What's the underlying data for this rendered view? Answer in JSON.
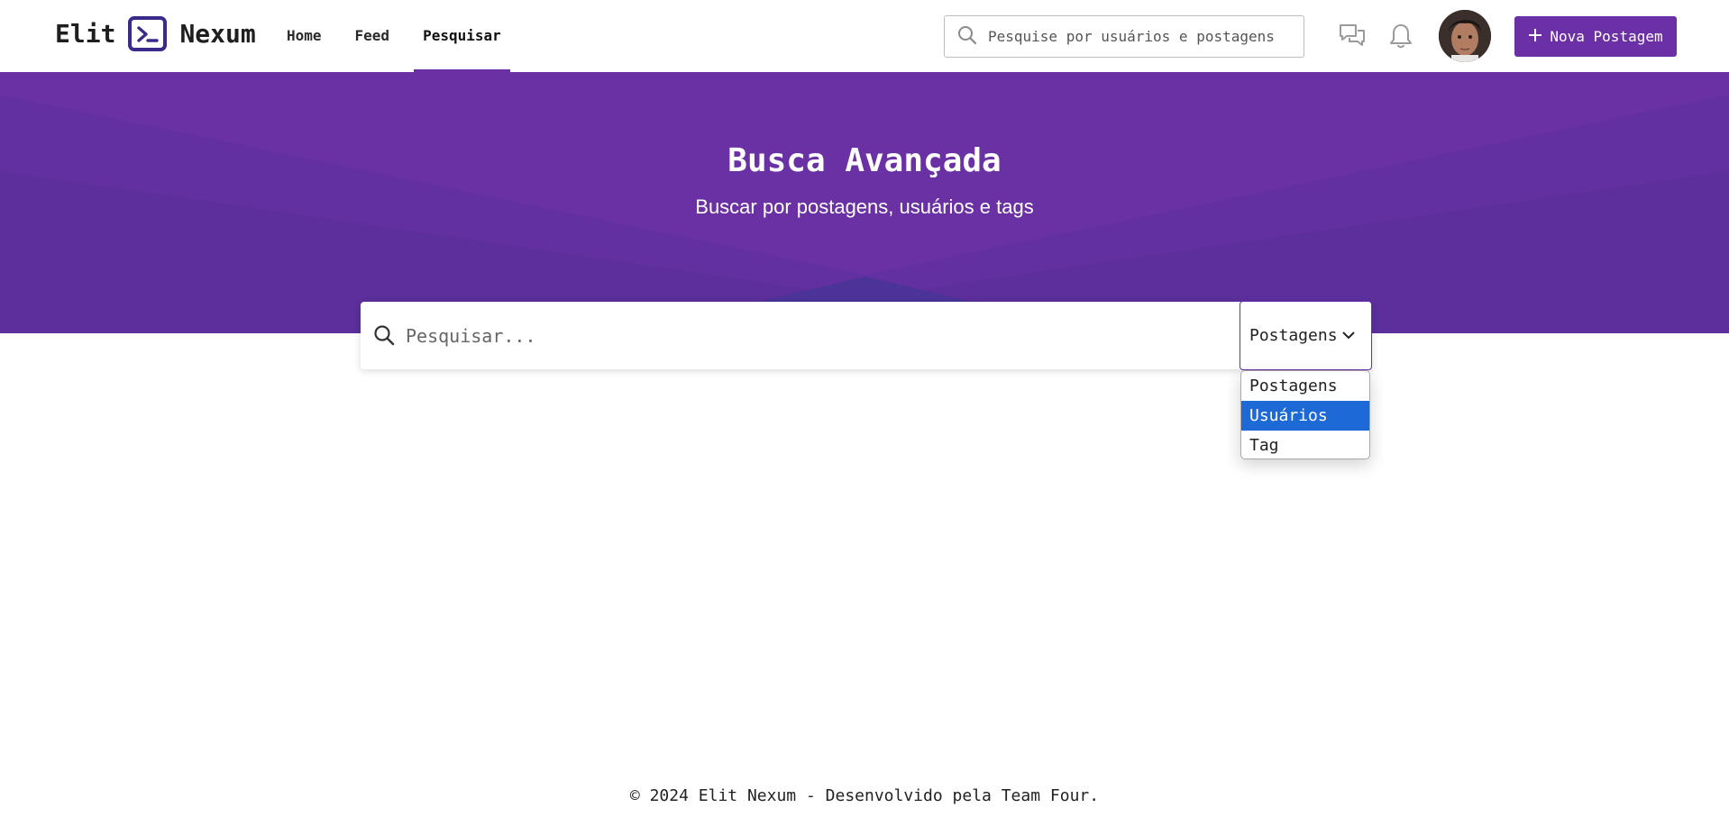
{
  "brand": {
    "name_left": "Elit",
    "name_right": "Nexum",
    "logo_icon": "terminal-prompt-icon"
  },
  "nav": {
    "items": [
      {
        "label": "Home",
        "active": false
      },
      {
        "label": "Feed",
        "active": false
      },
      {
        "label": "Pesquisar",
        "active": true
      }
    ]
  },
  "header": {
    "search_placeholder": "Pesquise por usuários e postagens",
    "messages_icon": "chat-bubbles-icon",
    "notifications_icon": "bell-icon",
    "new_post_label": "Nova Postagem"
  },
  "hero": {
    "title": "Busca Avançada",
    "subtitle": "Buscar por postagens, usuários e tags"
  },
  "search": {
    "placeholder": "Pesquisar...",
    "selected": "Postagens",
    "options": [
      "Postagens",
      "Usuários",
      "Tag"
    ],
    "highlighted": "Usuários"
  },
  "footer": {
    "text": "© 2024 Elit Nexum - Desenvolvido pela Team Four."
  },
  "colors": {
    "accent": "#6b2fa6",
    "hero": "#6a31a4",
    "highlight": "#1d6ad7"
  }
}
